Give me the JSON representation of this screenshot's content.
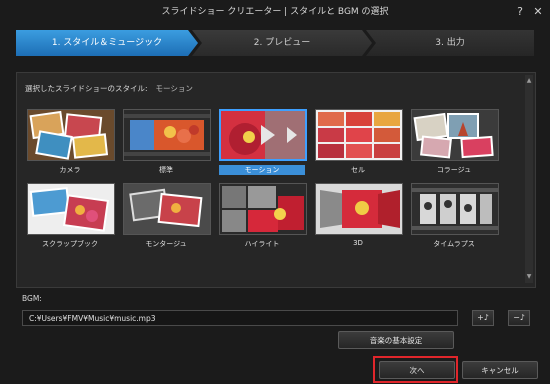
{
  "window": {
    "title": "スライドショー クリエーター | スタイルと BGM の選択",
    "help_label": "?",
    "close_label": "✕"
  },
  "steps": [
    {
      "label": "1. スタイル＆ミュージック",
      "active": true
    },
    {
      "label": "2. プレビュー",
      "active": false
    },
    {
      "label": "3. 出力",
      "active": false
    }
  ],
  "style_panel": {
    "label": "選択したスライドショーのスタイル:",
    "selected_value": "モーション",
    "styles": [
      {
        "label": "カメラ"
      },
      {
        "label": "標準"
      },
      {
        "label": "モーション",
        "selected": true
      },
      {
        "label": "セル"
      },
      {
        "label": "コラージュ"
      },
      {
        "label": "スクラップブック"
      },
      {
        "label": "モンタージュ"
      },
      {
        "label": "ハイライト"
      },
      {
        "label": "3D"
      },
      {
        "label": "タイムラプス"
      }
    ]
  },
  "bgm": {
    "label": "BGM:",
    "path": "C:¥Users¥FMV¥Music¥music.mp3",
    "add_icon": "music-add-icon",
    "remove_icon": "music-remove-icon"
  },
  "buttons": {
    "music_settings": "音楽の基本設定",
    "next": "次へ",
    "cancel": "キャンセル"
  },
  "colors": {
    "accent": "#2a86d8",
    "highlight_border": "#e0262b",
    "background": "#1b1b1b"
  }
}
